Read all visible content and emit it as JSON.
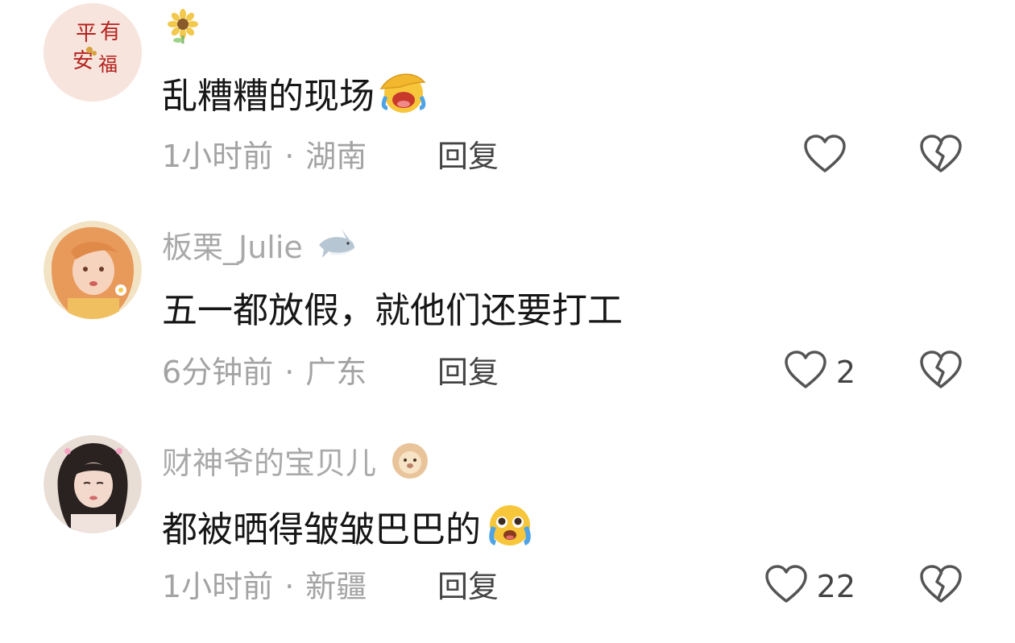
{
  "comments": [
    {
      "username": "",
      "badge_icon": "sunflower-icon",
      "avatar_text": [
        "平",
        "有",
        "安",
        "福"
      ],
      "text": "乱糟糟的现场",
      "emoji": "facepalm-laugh-emoji",
      "time": "1小时前",
      "location": "湖南",
      "reply_label": "回复",
      "likes": "",
      "like_icon": "heart-outline-icon",
      "dislike_icon": "broken-heart-icon"
    },
    {
      "username": "板栗_Julie",
      "badge_icon": "shark-icon",
      "text": "五一都放假，就他们还要打工",
      "emoji": "",
      "time": "6分钟前",
      "location": "广东",
      "reply_label": "回复",
      "likes": "2",
      "like_icon": "heart-outline-icon",
      "dislike_icon": "broken-heart-icon"
    },
    {
      "username": "财神爷的宝贝儿",
      "badge_icon": "lion-icon",
      "text": "都被晒得皱皱巴巴的",
      "emoji": "pleading-crying-emoji",
      "time": "1小时前",
      "location": "新疆",
      "reply_label": "回复",
      "likes": "22",
      "like_icon": "heart-outline-icon",
      "dislike_icon": "broken-heart-icon"
    }
  ],
  "meta_separator": "·",
  "colors": {
    "username": "#a9a9a9",
    "text": "#161616",
    "meta": "#a3a3a3",
    "reply": "#444444",
    "icon": "#555555"
  }
}
